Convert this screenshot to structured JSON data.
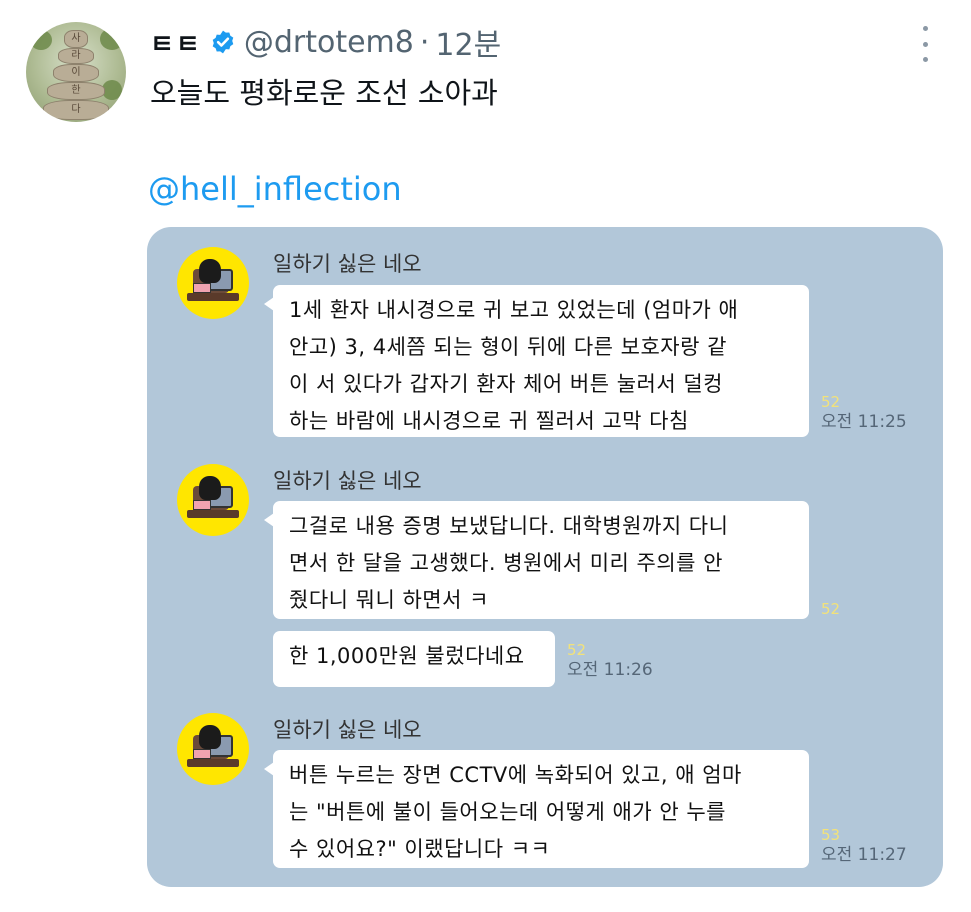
{
  "tweet": {
    "author": {
      "display_name": "ㅌㅌ",
      "handle": "@drtotem8",
      "separator": "·",
      "time": "12분",
      "avatar_text": [
        "사",
        "라",
        "이",
        "한",
        "다"
      ]
    },
    "text": "오늘도 평화로운 조선 소아과",
    "mention": "@hell_inflection"
  },
  "chat": {
    "messages": [
      {
        "sender": "일하기 싫은 네오",
        "lines": [
          "1세 환자 내시경으로 귀 보고 있었는데 (엄마가 애",
          " 안고) 3, 4세쯤 되는 형이 뒤에 다른 보호자랑 같",
          "이 서 있다가 갑자기 환자 체어 버튼 눌러서 덜컹",
          "하는 바람에 내시경으로 귀 찔러서 고막 다침"
        ],
        "count": "52",
        "time": "오전 11:25"
      },
      {
        "sender": "일하기 싫은 네오",
        "lines": [
          "그걸로 내용 증명 보냈답니다. 대학병원까지 다니",
          "면서 한 달을 고생했다. 병원에서 미리 주의를 안",
          "줬다니 뭐니 하면서 ㅋ"
        ],
        "count": "52"
      },
      {
        "lines": [
          "한 1,000만원 불렀다네요"
        ],
        "count": "52",
        "time": "오전 11:26"
      },
      {
        "sender": "일하기 싫은 네오",
        "lines": [
          "버튼 누르는 장면 CCTV에 녹화되어 있고, 애 엄마",
          "는 \"버튼에 불이 들어오는데 어떻게 애가 안 누를",
          "수 있어요?\" 이랬답니다 ㅋㅋ"
        ],
        "count": "53",
        "time": "오전 11:27"
      }
    ]
  },
  "icons": {
    "verified": "verified-badge-icon",
    "more": "more-options-icon"
  },
  "colors": {
    "chat_background": "#b2c7d9",
    "mention": "#1d9bf0",
    "verified": "#1d9bf0",
    "profile_yellow": "#ffe600",
    "unread_count": "#f2e27a"
  }
}
